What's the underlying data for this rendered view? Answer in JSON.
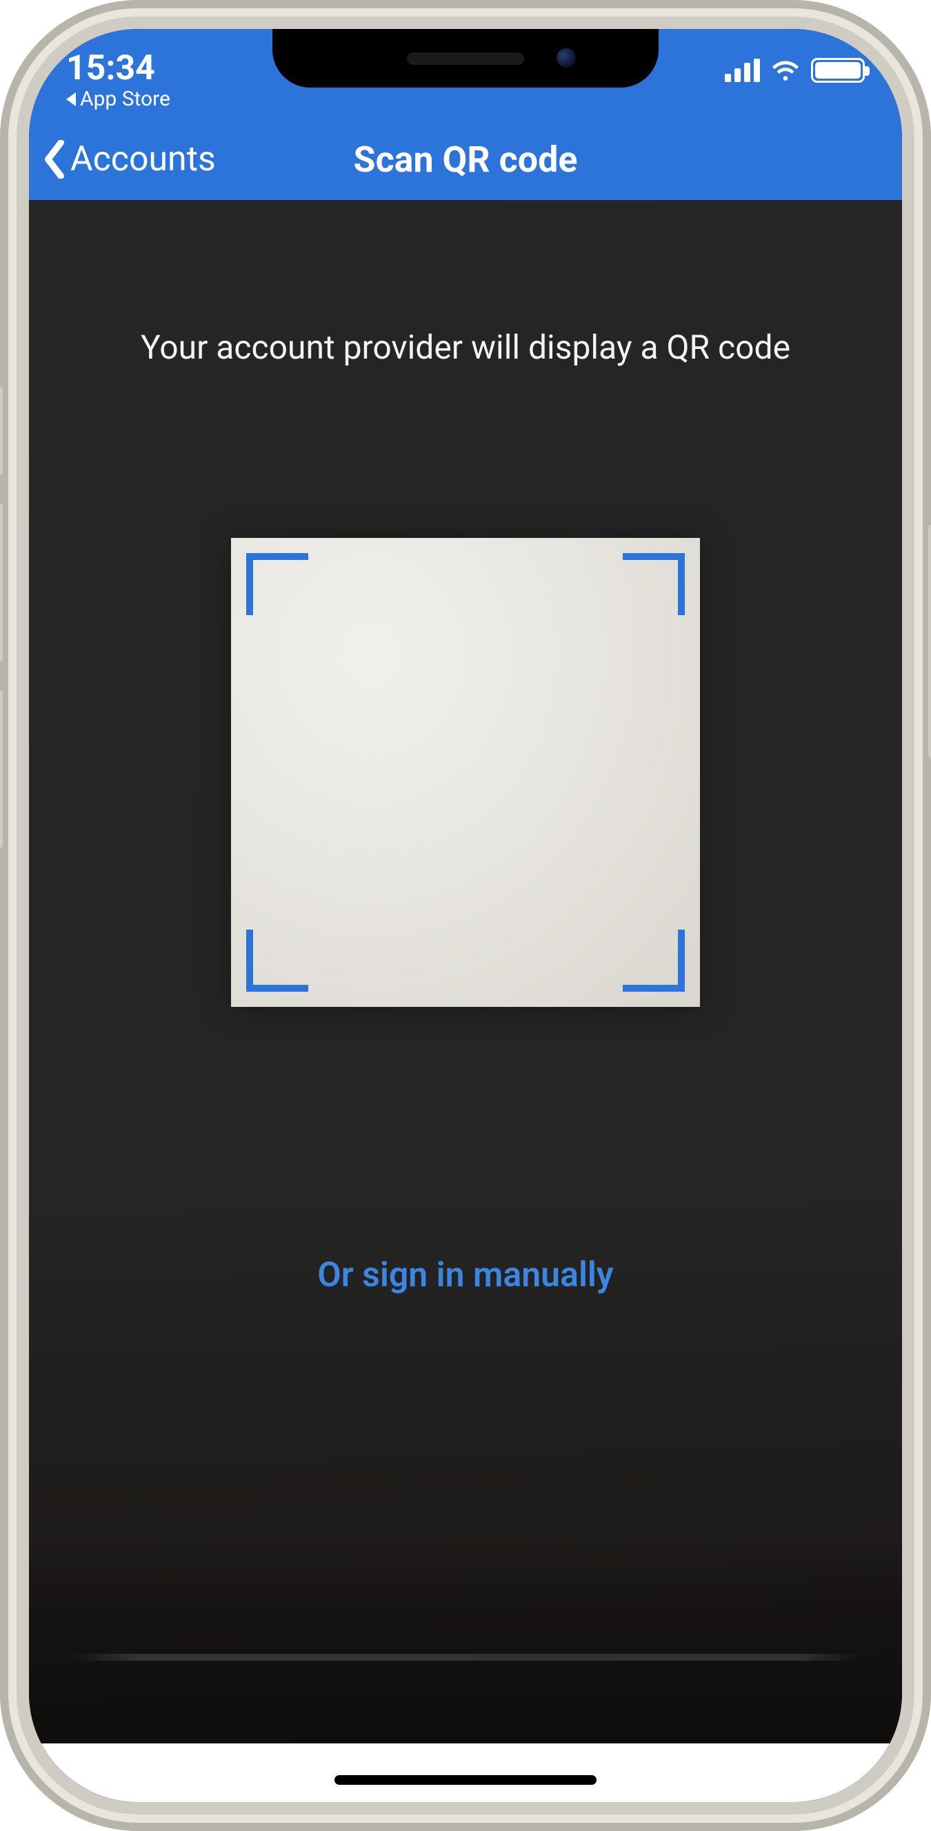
{
  "statusbar": {
    "time": "15:34",
    "back_app_label": "App Store"
  },
  "nav": {
    "back_label": "Accounts",
    "title": "Scan QR code"
  },
  "content": {
    "instruction": "Your account provider will display a QR code",
    "manual_link": "Or sign in manually"
  },
  "colors": {
    "accent": "#2d74da",
    "link": "#3a86e0"
  }
}
